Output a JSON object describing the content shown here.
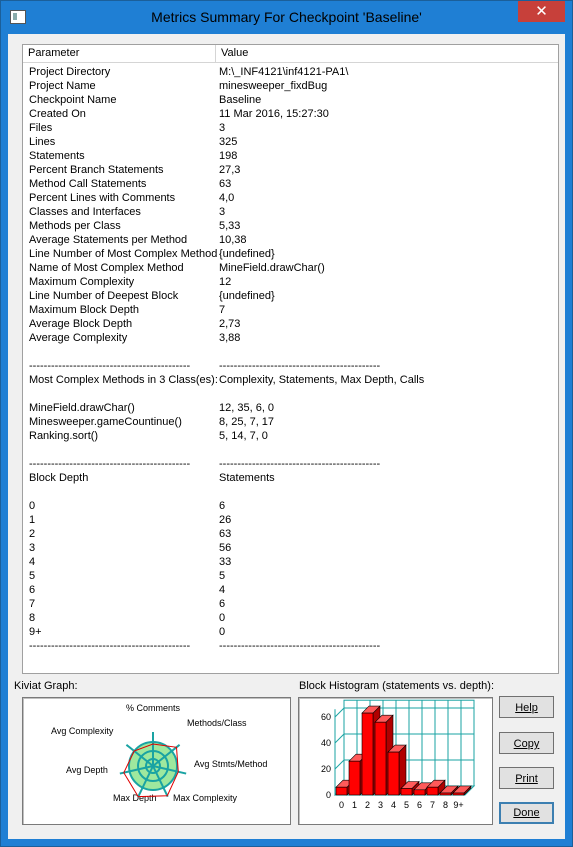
{
  "window": {
    "title": "Metrics Summary For Checkpoint 'Baseline'",
    "close_glyph": "✕"
  },
  "table": {
    "columns": [
      "Parameter",
      "Value"
    ],
    "rows": [
      [
        "Project Directory",
        "M:\\_INF4121\\inf4121-PA1\\"
      ],
      [
        "Project Name",
        "minesweeper_fixdBug"
      ],
      [
        "Checkpoint Name",
        "Baseline"
      ],
      [
        "Created On",
        "11 Mar 2016, 15:27:30"
      ],
      [
        "Files",
        "3"
      ],
      [
        "Lines",
        "325"
      ],
      [
        "Statements",
        "198"
      ],
      [
        "Percent Branch Statements",
        "27,3"
      ],
      [
        "Method Call Statements",
        "63"
      ],
      [
        "Percent Lines with Comments",
        "4,0"
      ],
      [
        "Classes and Interfaces",
        "3"
      ],
      [
        "Methods per Class",
        "5,33"
      ],
      [
        "Average Statements per Method",
        "10,38"
      ],
      [
        "Line Number of Most Complex Method",
        "{undefined}"
      ],
      [
        "Name of Most Complex Method",
        "MineField.drawChar()"
      ],
      [
        "Maximum Complexity",
        "12"
      ],
      [
        "Line Number of Deepest Block",
        "{undefined}"
      ],
      [
        "Maximum Block Depth",
        "7"
      ],
      [
        "Average Block Depth",
        "2,73"
      ],
      [
        "Average Complexity",
        "3,88"
      ],
      [
        "",
        ""
      ],
      [
        "--------------------------------------------",
        "--------------------------------------------"
      ],
      [
        "Most Complex Methods in 3 Class(es):",
        "Complexity, Statements, Max Depth, Calls"
      ],
      [
        "",
        ""
      ],
      [
        "MineField.drawChar()",
        "12, 35, 6, 0"
      ],
      [
        "Minesweeper.gameCountinue()",
        "8, 25, 7, 17"
      ],
      [
        "Ranking.sort()",
        "5, 14, 7, 0"
      ],
      [
        "",
        ""
      ],
      [
        "--------------------------------------------",
        "--------------------------------------------"
      ],
      [
        "Block Depth",
        "Statements"
      ],
      [
        "",
        ""
      ],
      [
        "0",
        "6"
      ],
      [
        "1",
        "26"
      ],
      [
        "2",
        "63"
      ],
      [
        "3",
        "56"
      ],
      [
        "4",
        "33"
      ],
      [
        "5",
        "5"
      ],
      [
        "6",
        "4"
      ],
      [
        "7",
        "6"
      ],
      [
        "8",
        "0"
      ],
      [
        "9+",
        "0"
      ],
      [
        "--------------------------------------------",
        "--------------------------------------------"
      ]
    ]
  },
  "kiviat": {
    "label": "Kiviat Graph:",
    "axes": [
      "% Comments",
      "Methods/Class",
      "Avg Stmts/Method",
      "Max Complexity",
      "Max Depth",
      "Avg Depth",
      "Avg Complexity"
    ],
    "fill_color": "#9ee89e",
    "ring_color": "#1aa3a3",
    "outline_color": "#e00000"
  },
  "histogram": {
    "label": "Block Histogram (statements vs. depth):",
    "bar_color": "#ff0000",
    "grid_color": "#1aa3a3"
  },
  "buttons": {
    "help": "Help",
    "copy": "Copy",
    "print": "Print",
    "done": "Done"
  },
  "chart_data": {
    "type": "bar",
    "categories": [
      "0",
      "1",
      "2",
      "3",
      "4",
      "5",
      "6",
      "7",
      "8",
      "9+"
    ],
    "values": [
      6,
      26,
      63,
      56,
      33,
      5,
      4,
      6,
      0,
      0
    ],
    "title": "Block Histogram (statements vs. depth):",
    "xlabel": "",
    "ylabel": "",
    "ylim": [
      0,
      60
    ],
    "yticks": [
      0,
      20,
      40,
      60
    ],
    "grid": true,
    "style": "3d"
  }
}
